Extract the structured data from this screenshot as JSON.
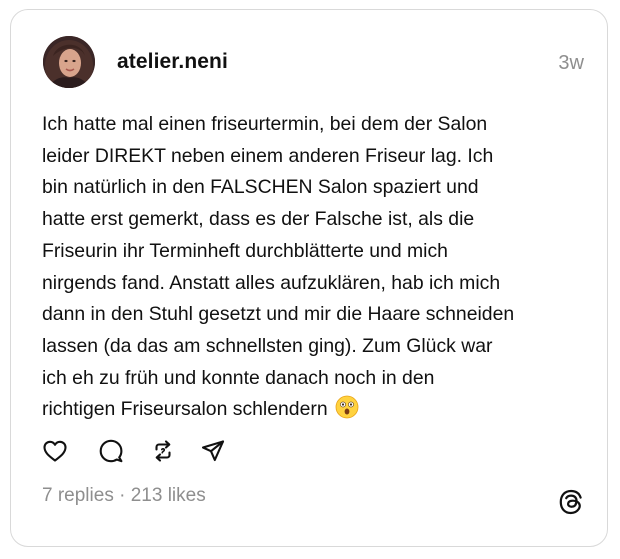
{
  "post": {
    "author": {
      "username": "atelier.neni",
      "avatar_icon": "profile-photo"
    },
    "time": "3w",
    "body_lines": [
      "Ich hatte mal einen friseurtermin, bei dem der Salon",
      "leider DIREKT neben einem anderen Friseur lag. Ich",
      "bin natürlich in den FALSCHEN Salon spaziert und",
      "hatte erst gemerkt, dass es der Falsche ist, als die",
      "Friseurin ihr Terminheft durchblätterte und mich",
      "nirgends fand. Anstatt alles aufzuklären, hab ich mich",
      "dann in den Stuhl gesetzt und mir die Haare schneiden",
      "lassen (da das am schnellsten ging). Zum Glück war",
      "ich eh zu früh und konnte danach noch in den",
      "richtigen Friseursalon schlendern"
    ],
    "emoji": "astonished-face",
    "stats": {
      "replies": "7 replies",
      "separator": " · ",
      "likes": "213 likes"
    }
  },
  "actions": [
    {
      "icon": "heart-icon"
    },
    {
      "icon": "comment-icon"
    },
    {
      "icon": "repost-icon"
    },
    {
      "icon": "share-icon"
    }
  ],
  "branding": {
    "icon": "threads-logo-icon"
  },
  "colors": {
    "text": "#111111",
    "muted": "#8e8e8e",
    "border": "#d9d9d9",
    "background": "#ffffff"
  }
}
